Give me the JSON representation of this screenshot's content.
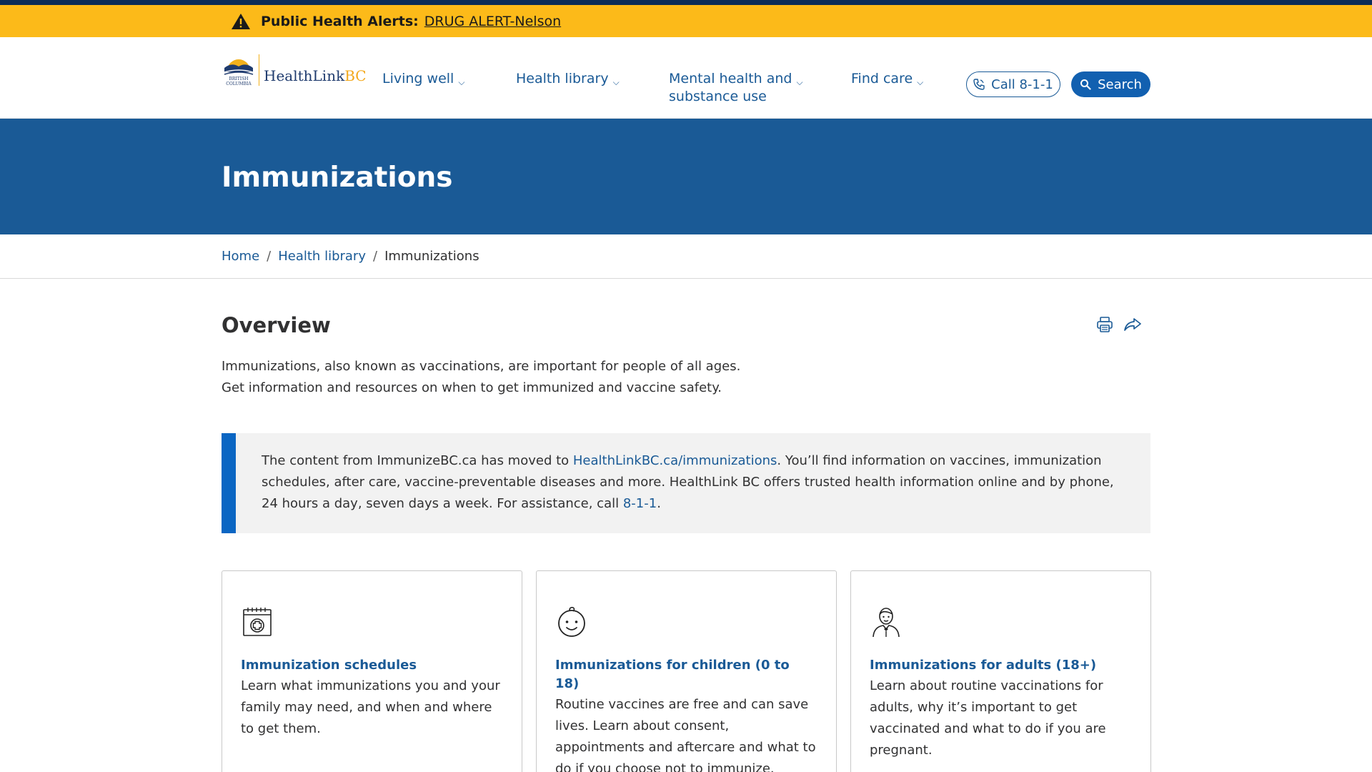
{
  "alert": {
    "label": "Public Health Alerts:",
    "link": "DRUG ALERT-Nelson",
    "icon": "warning-icon"
  },
  "logo": {
    "seal_line1": "BRITISH",
    "seal_line2": "COLUMBIA",
    "name_main": "HealthLink",
    "name_suffix": "BC"
  },
  "nav": {
    "items": [
      {
        "label": "Living well"
      },
      {
        "label": "Health library"
      },
      {
        "label": "Mental health and",
        "label2": "substance use"
      },
      {
        "label": "Find care"
      }
    ],
    "chevron": "⌵",
    "call_label": "Call 8-1-1",
    "search_label": "Search"
  },
  "hero": {
    "title": "Immunizations"
  },
  "breadcrumb": {
    "items": [
      "Home",
      "Health library",
      "Immunizations"
    ],
    "separator": "/"
  },
  "overview": {
    "heading": "Overview",
    "intro": "Immunizations, also known as vaccinations, are important for people of all ages. Get information and resources on when to get immunized and vaccine safety."
  },
  "callout": {
    "text_before": "The content from ImmunizeBC.ca has moved to ",
    "link": "HealthLinkBC.ca/immunizations",
    "text_middle": ". You’ll find information on vaccines, immunization schedules, after care, vaccine-preventable diseases and more. HealthLink BC offers trusted health information online and by phone, 24 hours a day, seven days a week. For assistance, call ",
    "phone": "8-1-1",
    "text_after": "."
  },
  "cards": [
    {
      "icon": "calendar-icon",
      "title": "Immunization schedules",
      "description": "Learn what immunizations you and your family may need, and when and where to get them."
    },
    {
      "icon": "baby-icon",
      "title": "Immunizations for children (0 to 18)",
      "description": "Routine vaccines are free and can save lives. Learn about consent, appointments and aftercare and what to do if you choose not to immunize."
    },
    {
      "icon": "adult-icon",
      "title": "Immunizations for adults (18+)",
      "description": "Learn about routine vaccinations for adults, why it’s important to get vaccinated and what to do if you are pregnant."
    }
  ],
  "colors": {
    "alert_bg": "#fcba19",
    "hero_bg": "#1a5a96",
    "link": "#1a5a96",
    "search_btn": "#1260b0",
    "callout_border": "#0b66c3"
  }
}
